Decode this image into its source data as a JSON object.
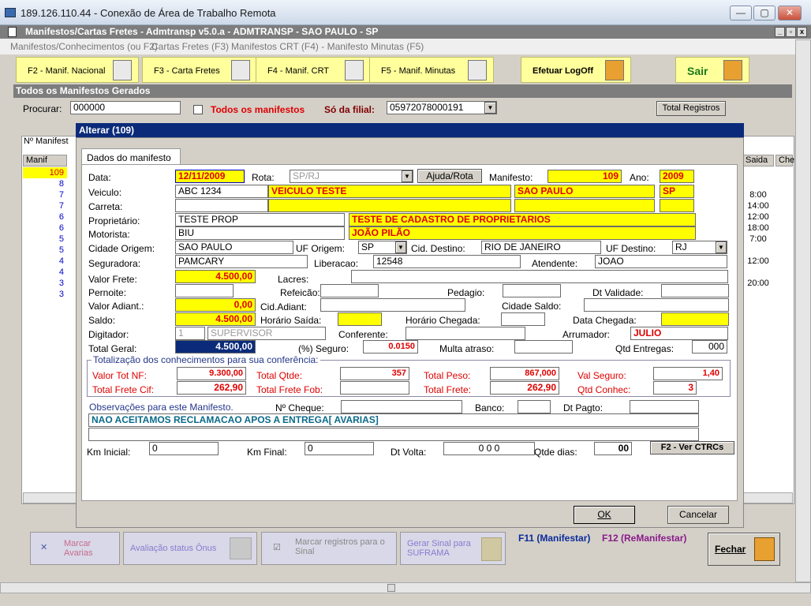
{
  "rdp": {
    "title": "189.126.110.44 - Conexão de Área de Trabalho Remota"
  },
  "app": {
    "title": "Manifestos/Cartas Fretes - Admtransp v5.0.a - ADMTRANSP - SAO PAULO - SP"
  },
  "menu": {
    "items": [
      "Manifestos/Conhecimentos (ou F2)",
      "Cartas Fretes (F3)",
      "Manifestos CRT (F4) - Manifesto Minutas (F5)"
    ]
  },
  "toolbar": {
    "b1": "F2 - Manif. Nacional",
    "b2": "F3 - Carta Fretes",
    "b3": "F4 - Manif. CRT",
    "b4": "F5 - Manif. Minutas",
    "b5": "Efetuar LogOff",
    "b6": "Sair"
  },
  "list": {
    "title": "Todos os Manifestos Gerados",
    "search_label": "Procurar:",
    "search_value": "000000",
    "all_label": "Todos os manifestos",
    "filial_label": "Só da filial:",
    "filial_value": "05972078000191",
    "total_btn": "Total Registros",
    "col_manif": "Nº Manifest",
    "col_manif2": "Manif",
    "col_saida": "Saida",
    "col_che": "Che",
    "rows": [
      "109",
      "8",
      "7",
      "7",
      "6",
      "6",
      "5",
      "5",
      "4",
      "4",
      "3",
      "3"
    ],
    "saidas": [
      "",
      "",
      "8:00",
      "14:00",
      "12:00",
      "18:00",
      "7:00",
      "",
      "12:00",
      "",
      "20:00",
      ""
    ]
  },
  "dialog": {
    "title": "Alterar  (109)",
    "tab": "Dados do manifesto",
    "data_label": "Data:",
    "data": "12/11/2009",
    "rota_label": "Rota:",
    "rota": "SP/RJ",
    "ajuda_btn": "Ajuda/Rota",
    "manifesto_label": "Manifesto:",
    "manifesto": "109",
    "ano_label": "Ano:",
    "ano": "2009",
    "veiculo_label": "Veiculo:",
    "veiculo": "ABC 1234",
    "veiculo_desc": "VEICULO TESTE",
    "veiculo_cidade": "SAO PAULO",
    "veiculo_uf": "SP",
    "carreta_label": "Carreta:",
    "proprietario_label": "Proprietário:",
    "proprietario": "TESTE PROP",
    "proprietario_desc": "TESTE DE CADASTRO DE PROPRIETARIOS",
    "motorista_label": "Motorista:",
    "motorista": "BIU",
    "motorista_desc": "JOÃO PILÃO",
    "cidade_origem_label": "Cidade Origem:",
    "cidade_origem": "SAO PAULO",
    "uf_origem_label": "UF Origem:",
    "uf_origem": "SP",
    "cid_destino_label": "Cid. Destino:",
    "cid_destino": "RIO DE JANEIRO",
    "uf_destino_label": "UF Destino:",
    "uf_destino": "RJ",
    "seguradora_label": "Seguradora:",
    "seguradora": "PAMCARY",
    "liberacao_label": "Liberacao:",
    "liberacao": "12548",
    "atendente_label": "Atendente:",
    "atendente": "JOAO",
    "valor_frete_label": "Valor Frete:",
    "valor_frete": "4.500,00",
    "lacres_label": "Lacres:",
    "pernoite_label": "Pernoite:",
    "refeicao_label": "Refeicão:",
    "pedagio_label": "Pedagio:",
    "dt_validade_label": "Dt Validade:",
    "valor_adiant_label": "Valor Adiant.:",
    "valor_adiant": "0,00",
    "cid_adiant_label": "Cid.Adiant:",
    "cidade_saldo_label": "Cidade Saldo:",
    "saldo_label": "Saldo:",
    "saldo": "4.500,00",
    "horario_saida_label": "Horário Saída:",
    "horario_chegada_label": "Horário Chegada:",
    "data_chegada_label": "Data Chegada:",
    "digitador_label": "Digitador:",
    "digitador_cod": "1",
    "digitador": "SUPERVISOR",
    "conferente_label": "Conferente:",
    "arrumador_label": "Arrumador:",
    "arrumador": "JULIO",
    "total_geral_label": "Total Geral:",
    "total_geral": "4.500,00",
    "seguro_label": "(%) Seguro:",
    "seguro": "0.0150",
    "multa_label": "Multa atraso:",
    "qtd_entregas_label": "Qtd Entregas:",
    "qtd_entregas": "000",
    "totaliz_label": "Totalização dos conhecimentos para sua conferência:",
    "valor_tot_nf_label": "Valor Tot NF:",
    "valor_tot_nf": "9.300,00",
    "total_qtde_label": "Total Qtde:",
    "total_qtde": "357",
    "total_peso_label": "Total Peso:",
    "total_peso": "867,000",
    "val_seguro_label": "Val Seguro:",
    "val_seguro": "1,40",
    "total_frete_cif_label": "Total Frete Cif:",
    "total_frete_cif": "262,90",
    "total_frete_fob_label": "Total Frete Fob:",
    "total_frete_label": "Total Frete:",
    "total_frete": "262,90",
    "qtd_conhec_label": "Qtd Conhec:",
    "qtd_conhec": "3",
    "obs_label": "Observações para este Manifesto.",
    "cheque_label": "Nº Cheque:",
    "banco_label": "Banco:",
    "dt_pagto_label": "Dt Pagto:",
    "obs1": "NAO ACEITAMOS RECLAMACAO APOS A ENTREGA[ AVARIAS]",
    "km_inicial_label": "Km Inicial:",
    "km_inicial": "0",
    "km_final_label": "Km Final:",
    "km_final": "0",
    "dt_volta_label": "Dt Volta:",
    "dt_volta": "0 0  0",
    "qtde_dias_label": "Qtde dias:",
    "qtde_dias": "00",
    "ver_ctrcs_btn": "F2 - Ver CTRCs",
    "ok_btn": "OK",
    "cancel_btn": "Cancelar"
  },
  "bottom": {
    "b1": "Marcar Avarias",
    "b2": "Avaliação status Ônus",
    "b3": "Marcar registros para o Sinal",
    "b4": "Gerar Sinal para SUFRAMA",
    "f11": "F11 (Manifestar)",
    "f12": "F12 (ReManifestar)",
    "fechar": "Fechar"
  }
}
